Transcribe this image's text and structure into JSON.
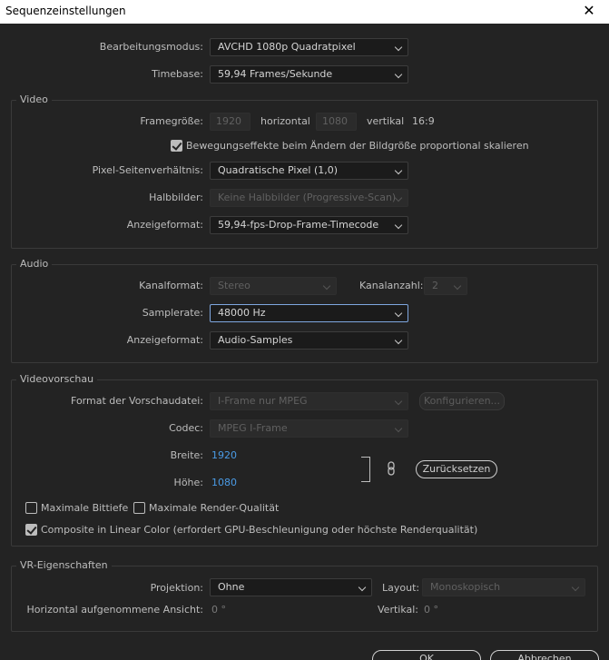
{
  "window": {
    "title": "Sequenzeinstellungen",
    "close": "✕"
  },
  "top": {
    "edit_mode_label": "Bearbeitungsmodus:",
    "edit_mode_value": "AVCHD 1080p Quadratpixel",
    "timebase_label": "Timebase:",
    "timebase_value": "59,94  Frames/Sekunde"
  },
  "video": {
    "title": "Video",
    "frame_size_label": "Framegröße:",
    "frame_width": "1920",
    "horizontal_label": "horizontal",
    "frame_height": "1080",
    "vertical_label": "vertikal",
    "aspect": "16:9",
    "scale_checkbox_label": "Bewegungseffekte beim Ändern der Bildgröße proportional skalieren",
    "scale_checked": true,
    "pixel_aspect_label": "Pixel-Seitenverhältnis:",
    "pixel_aspect_value": "Quadratische Pixel (1,0)",
    "fields_label": "Halbbilder:",
    "fields_value": "Keine Halbbilder (Progressive-Scan)",
    "display_format_label": "Anzeigeformat:",
    "display_format_value": "59,94-fps-Drop-Frame-Timecode"
  },
  "audio": {
    "title": "Audio",
    "channel_format_label": "Kanalformat:",
    "channel_format_value": "Stereo",
    "channel_count_label": "Kanalanzahl:",
    "channel_count_value": "2",
    "sample_rate_label": "Samplerate:",
    "sample_rate_value": "48000 Hz",
    "display_format_label": "Anzeigeformat:",
    "display_format_value": "Audio-Samples"
  },
  "preview": {
    "title": "Videovorschau",
    "format_label": "Format der Vorschaudatei:",
    "format_value": "I-Frame nur MPEG",
    "configure_button": "Konfigurieren...",
    "codec_label": "Codec:",
    "codec_value": "MPEG I-Frame",
    "width_label": "Breite:",
    "width_value": "1920",
    "height_label": "Höhe:",
    "height_value": "1080",
    "reset_button": "Zurücksetzen",
    "max_bit_depth_label": "Maximale Bittiefe",
    "max_bit_depth_checked": false,
    "max_render_label": "Maximale Render-Qualität",
    "max_render_checked": false,
    "composite_label": "Composite in Linear Color (erfordert GPU-Beschleunigung oder höchste Renderqualität)",
    "composite_checked": true
  },
  "vr": {
    "title": "VR-Eigenschaften",
    "projection_label": "Projektion:",
    "projection_value": "Ohne",
    "layout_label": "Layout:",
    "layout_value": "Monoskopisch",
    "h_view_label": "Horizontal aufgenommene Ansicht:",
    "h_view_value": "0 °",
    "v_label": "Vertikal:",
    "v_value": "0 °"
  },
  "footer": {
    "ok_button": "OK",
    "cancel_button": "Abbrechen"
  },
  "colors": {
    "background": "#232323",
    "accent_blue": "#4a9be6",
    "focus_border": "#7fa7e0"
  },
  "icons": {
    "link": "link-icon",
    "dropdown": "chevron-down-icon",
    "check": "checkmark-icon"
  }
}
